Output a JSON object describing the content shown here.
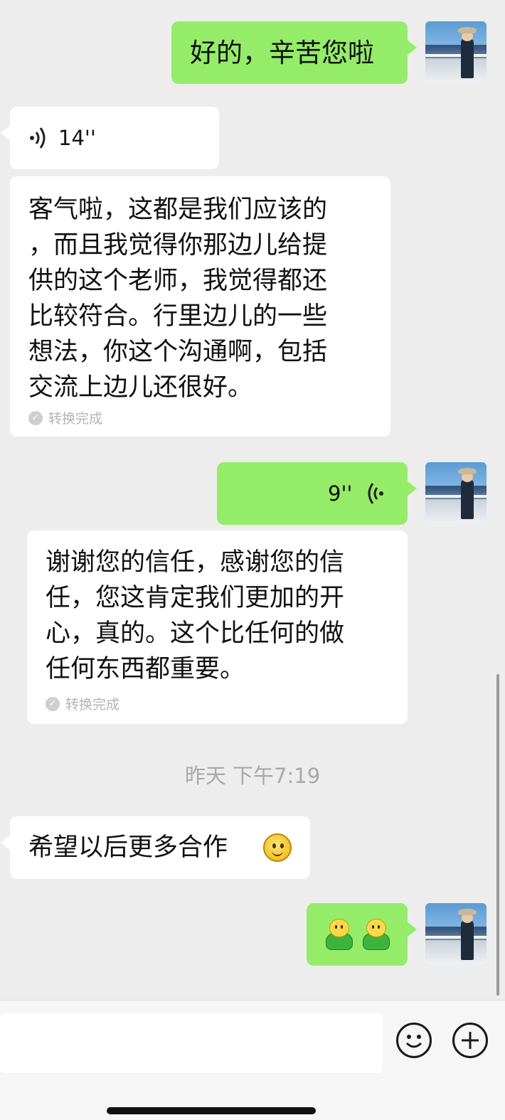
{
  "messages": {
    "m1": {
      "text": "好的，辛苦您啦"
    },
    "m2": {
      "duration": "14''"
    },
    "m3": {
      "lines": [
        "客气啦，这都是我们应该的",
        "，而且我觉得你那边儿给提",
        "供的这个老师，我觉得都还",
        "比较符合。行里边儿的一些",
        "想法，你这个沟通啊，包括",
        "交流上边儿还很好。"
      ],
      "status": "转换完成"
    },
    "m4": {
      "duration": "9''"
    },
    "m5": {
      "lines": [
        "谢谢您的信任，感谢您的信",
        "任，您这肯定我们更加的开",
        "心，真的。这个比任何的做",
        "任何东西都重要。"
      ],
      "status": "转换完成"
    },
    "timestamp": "昨天 下午7:19",
    "m6": {
      "text": "希望以后更多合作"
    }
  },
  "icons": {
    "voice_in": "voice-wave-icon",
    "voice_out": "voice-wave-icon",
    "emoji": "smile-emoji-icon",
    "plus": "plus-circle-icon"
  },
  "colors": {
    "outgoing_bubble": "#95ec69",
    "incoming_bubble": "#ffffff",
    "background": "#ededed"
  }
}
